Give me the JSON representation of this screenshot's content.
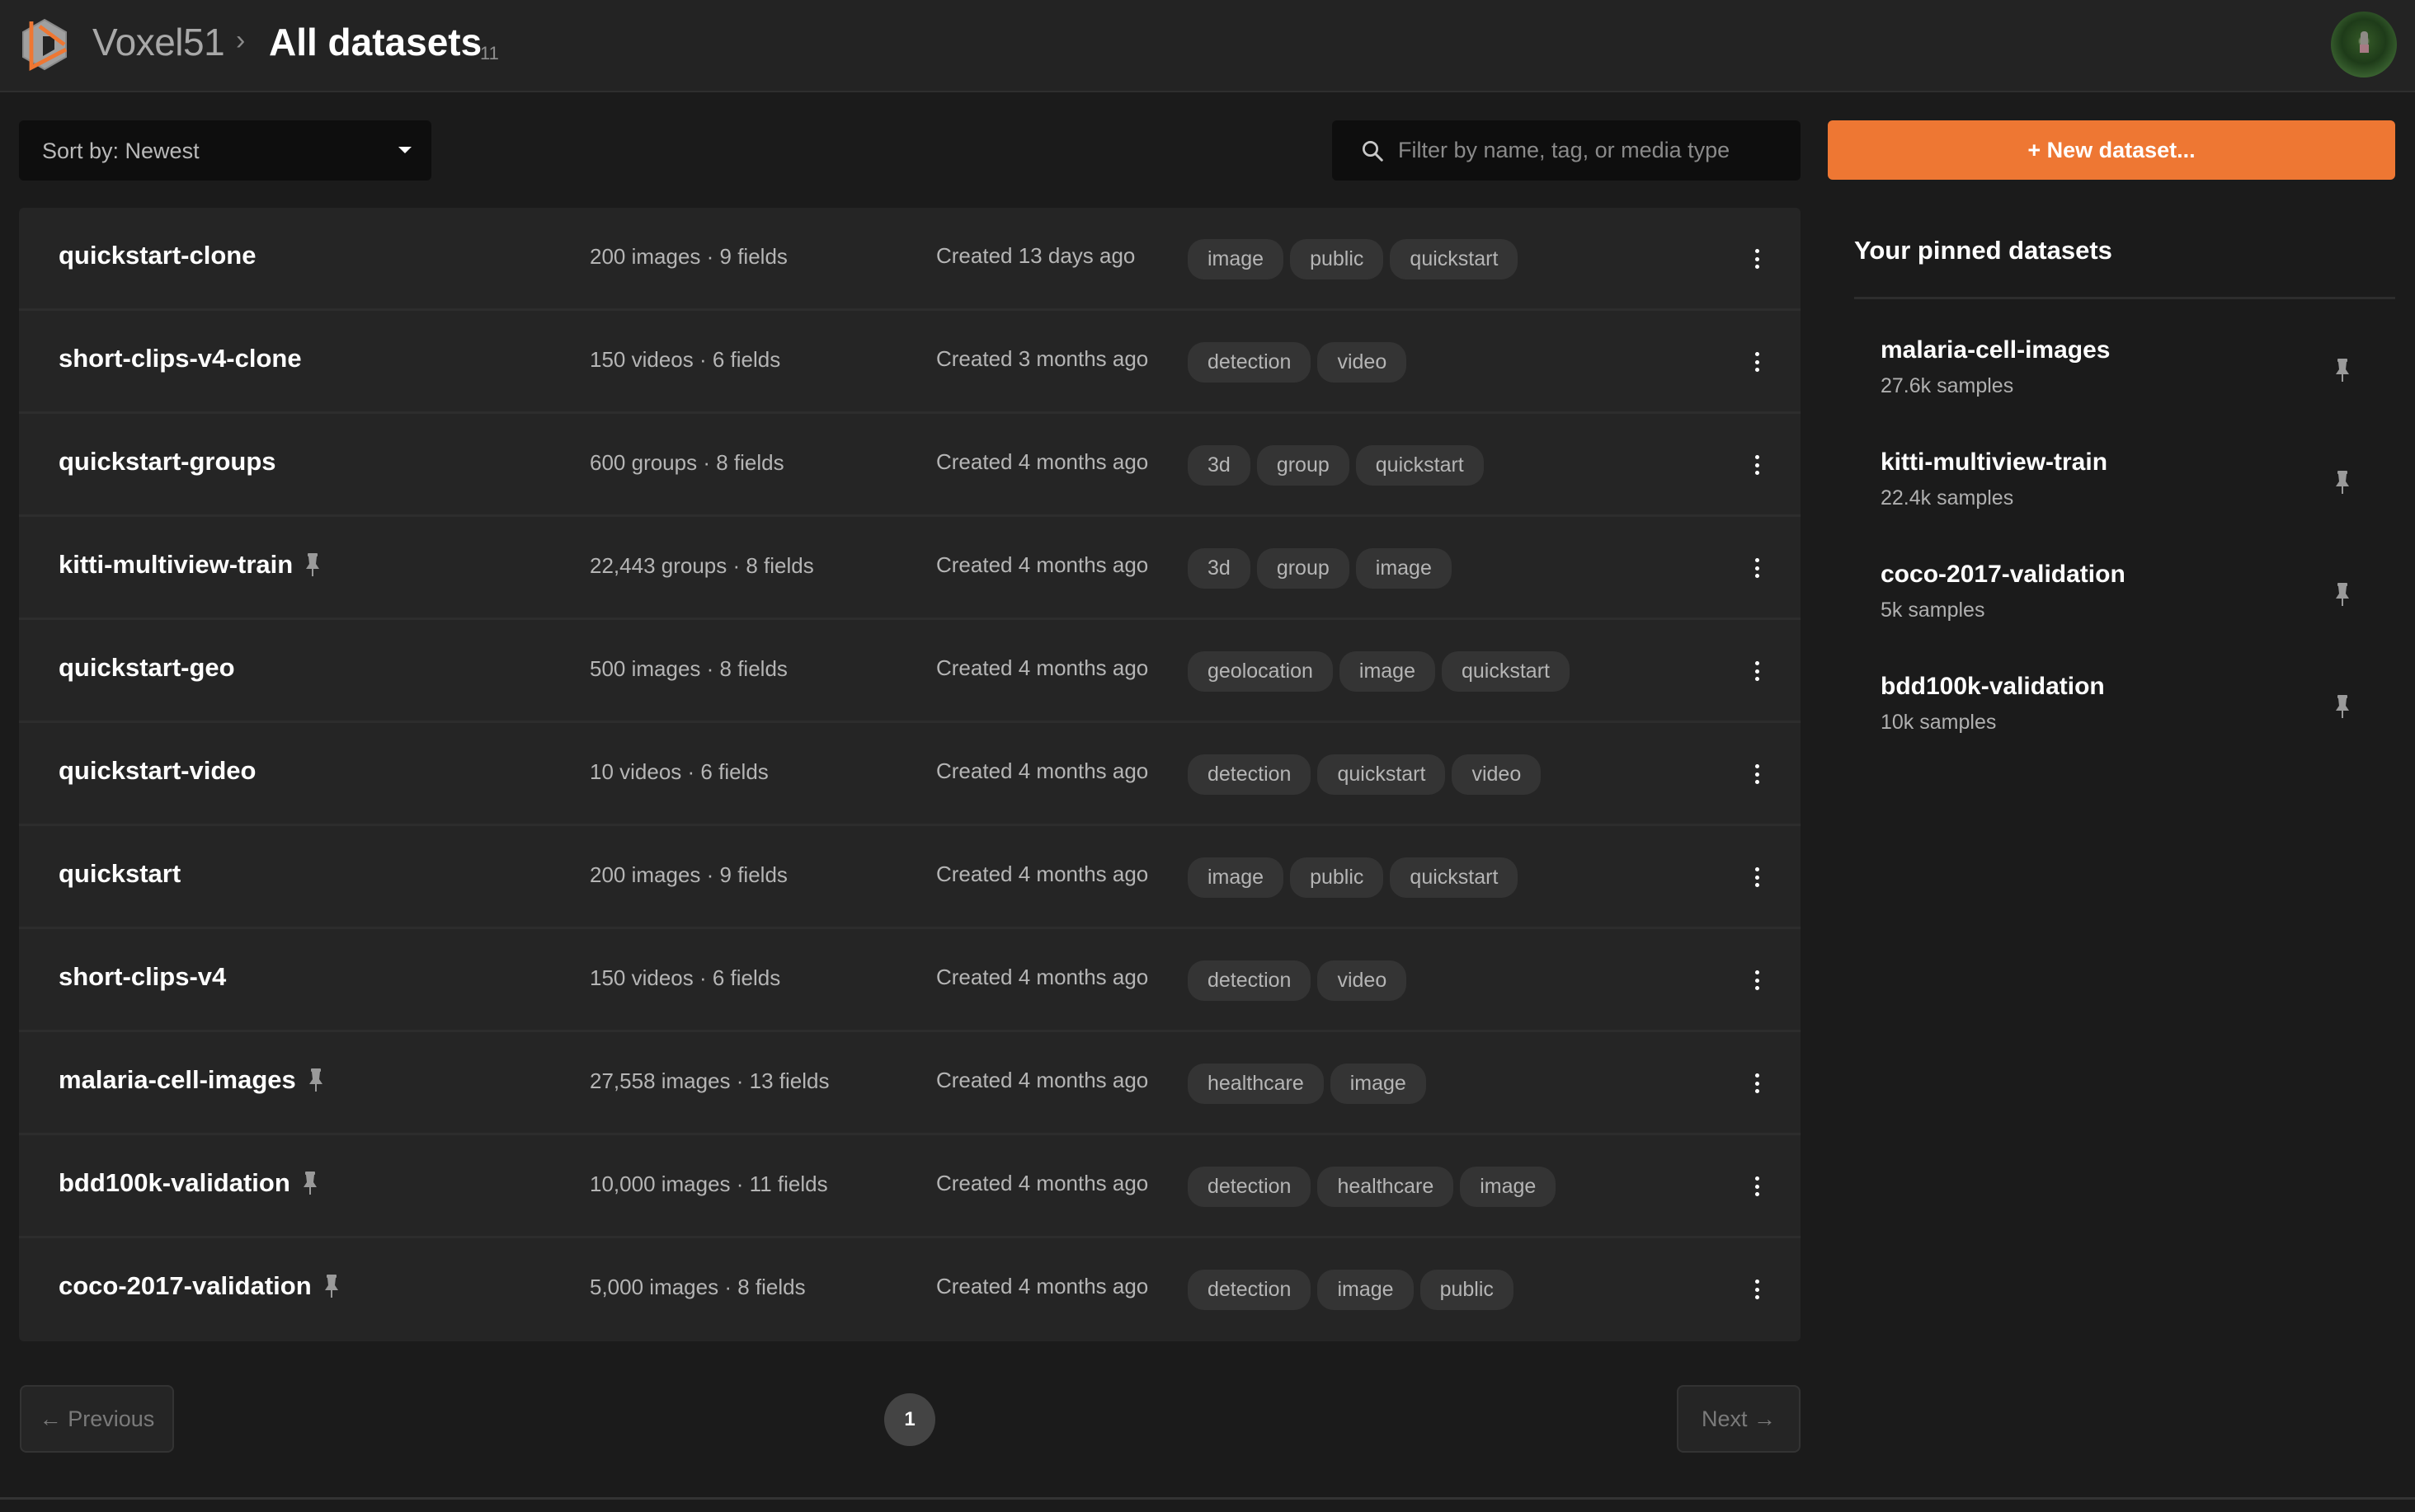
{
  "header": {
    "brand": "Voxel51",
    "breadcrumb_separator": "›",
    "title": "All datasets",
    "dataset_count": "11",
    "logo_icon": "voxel51-logo",
    "avatar_icon": "user-avatar"
  },
  "toolbar": {
    "sort_label": "Sort by: Newest",
    "filter_placeholder": "Filter by name, tag, or media type",
    "filter_value": "",
    "new_dataset_label": "+ New dataset..."
  },
  "colors": {
    "accent": "#ee7733",
    "background": "#1b1b1b",
    "header": "#232323",
    "row": "#252525",
    "tag": "#343434"
  },
  "datasets": [
    {
      "name": "quickstart-clone",
      "pinned": false,
      "stats": "200 images · 9 fields",
      "created": "Created 13 days ago",
      "tags": [
        "image",
        "public",
        "quickstart"
      ]
    },
    {
      "name": "short-clips-v4-clone",
      "pinned": false,
      "stats": "150 videos · 6 fields",
      "created": "Created 3 months ago",
      "tags": [
        "detection",
        "video"
      ]
    },
    {
      "name": "quickstart-groups",
      "pinned": false,
      "stats": "600 groups · 8 fields",
      "created": "Created 4 months ago",
      "tags": [
        "3d",
        "group",
        "quickstart"
      ]
    },
    {
      "name": "kitti-multiview-train",
      "pinned": true,
      "stats": "22,443 groups · 8 fields",
      "created": "Created 4 months ago",
      "tags": [
        "3d",
        "group",
        "image"
      ]
    },
    {
      "name": "quickstart-geo",
      "pinned": false,
      "stats": "500 images · 8 fields",
      "created": "Created 4 months ago",
      "tags": [
        "geolocation",
        "image",
        "quickstart"
      ]
    },
    {
      "name": "quickstart-video",
      "pinned": false,
      "stats": "10 videos · 6 fields",
      "created": "Created 4 months ago",
      "tags": [
        "detection",
        "quickstart",
        "video"
      ]
    },
    {
      "name": "quickstart",
      "pinned": false,
      "stats": "200 images · 9 fields",
      "created": "Created 4 months ago",
      "tags": [
        "image",
        "public",
        "quickstart"
      ]
    },
    {
      "name": "short-clips-v4",
      "pinned": false,
      "stats": "150 videos · 6 fields",
      "created": "Created 4 months ago",
      "tags": [
        "detection",
        "video"
      ]
    },
    {
      "name": "malaria-cell-images",
      "pinned": true,
      "stats": "27,558 images · 13 fields",
      "created": "Created 4 months ago",
      "tags": [
        "healthcare",
        "image"
      ]
    },
    {
      "name": "bdd100k-validation",
      "pinned": true,
      "stats": "10,000 images · 11 fields",
      "created": "Created 4 months ago",
      "tags": [
        "detection",
        "healthcare",
        "image"
      ]
    },
    {
      "name": "coco-2017-validation",
      "pinned": true,
      "stats": "5,000 images · 8 fields",
      "created": "Created 4 months ago",
      "tags": [
        "detection",
        "image",
        "public"
      ]
    }
  ],
  "pinned": {
    "title": "Your pinned datasets",
    "items": [
      {
        "name": "malaria-cell-images",
        "samples": "27.6k samples"
      },
      {
        "name": "kitti-multiview-train",
        "samples": "22.4k samples"
      },
      {
        "name": "coco-2017-validation",
        "samples": "5k samples"
      },
      {
        "name": "bdd100k-validation",
        "samples": "10k samples"
      }
    ]
  },
  "pagination": {
    "previous_label": "← Previous",
    "next_label": "Next →",
    "current_page": "1"
  }
}
